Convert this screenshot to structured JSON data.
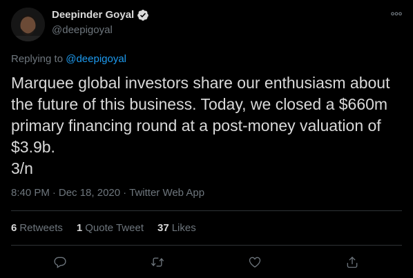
{
  "author": {
    "display_name": "Deepinder Goyal",
    "handle": "@deepigoyal",
    "verified": true
  },
  "reply": {
    "prefix": "Replying to ",
    "mention": "@deepigoyal"
  },
  "tweet": {
    "text": "Marquee global investors share our enthusiasm about the future of this business. Today, we closed a $660m primary financing round at a post-money valuation of $3.9b.\n3/n",
    "time": "8:40 PM",
    "date": "Dec 18, 2020",
    "separator": "·",
    "source": "Twitter Web App"
  },
  "stats": {
    "retweets_count": "6",
    "retweets_label": "Retweets",
    "quotes_count": "1",
    "quotes_label": "Quote Tweet",
    "likes_count": "37",
    "likes_label": "Likes"
  },
  "icons": {
    "more": "more-icon",
    "reply": "reply-icon",
    "retweet": "retweet-icon",
    "like": "heart-icon",
    "share": "share-icon",
    "verified": "verified-badge-icon"
  },
  "colors": {
    "background": "#000000",
    "text": "#d9d9d9",
    "muted": "#6e767d",
    "accent": "#1d9bf0",
    "divider": "#2f3336"
  }
}
